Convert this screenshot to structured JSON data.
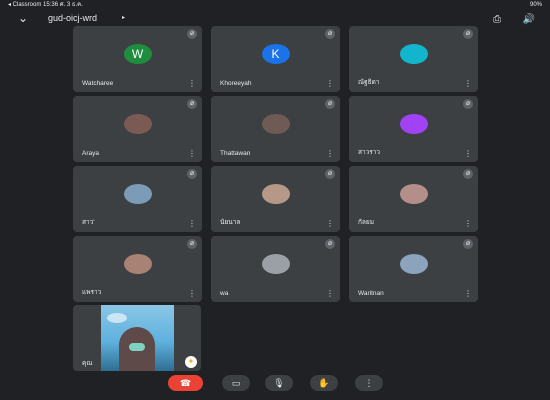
{
  "status": {
    "left": "◂ Classroom  15:36  ศ. 3 ธ.ค.",
    "right": "90%"
  },
  "meeting": {
    "code": "gud-oicj-wrd"
  },
  "participants": [
    {
      "name": "Watcharee",
      "initial": "W",
      "avatar_color": "#1e8e3e"
    },
    {
      "name": "Khoreeyah",
      "initial": "K",
      "avatar_color": "#1a73e8"
    },
    {
      "name": "ณัฐธิดา",
      "initial": "",
      "avatar_color": "#12b5cb"
    },
    {
      "name": "Araya",
      "initial": "",
      "avatar_color": "#7a5a52"
    },
    {
      "name": "Thattawan",
      "initial": "",
      "avatar_color": "#6f5a55"
    },
    {
      "name": "สาวราว",
      "initial": "",
      "avatar_color": "#a142f4"
    },
    {
      "name": "สาว'",
      "initial": "",
      "avatar_color": "#7b9bb6"
    },
    {
      "name": "นัยนาล",
      "initial": "",
      "avatar_color": "#b69889"
    },
    {
      "name": "กัลยม",
      "initial": "",
      "avatar_color": "#b48f8a"
    },
    {
      "name": "แพราว",
      "initial": "",
      "avatar_color": "#a88274"
    },
    {
      "name": "wa",
      "initial": "",
      "avatar_color": "#9aa0a6"
    },
    {
      "name": "Waritnan",
      "initial": "",
      "avatar_color": "#8ba3bd"
    }
  ],
  "self": {
    "name": "คุณ"
  },
  "icons": {
    "back": "chevron-down-icon",
    "camera_switch": "camera-switch-icon",
    "audio": "speaker-icon",
    "mute": "mic-off-icon",
    "more": "more-vert-icon",
    "end": "call-end-icon",
    "video": "videocam-icon",
    "mic": "mic-icon",
    "hand": "raise-hand-icon",
    "effects": "sparkle-icon"
  }
}
